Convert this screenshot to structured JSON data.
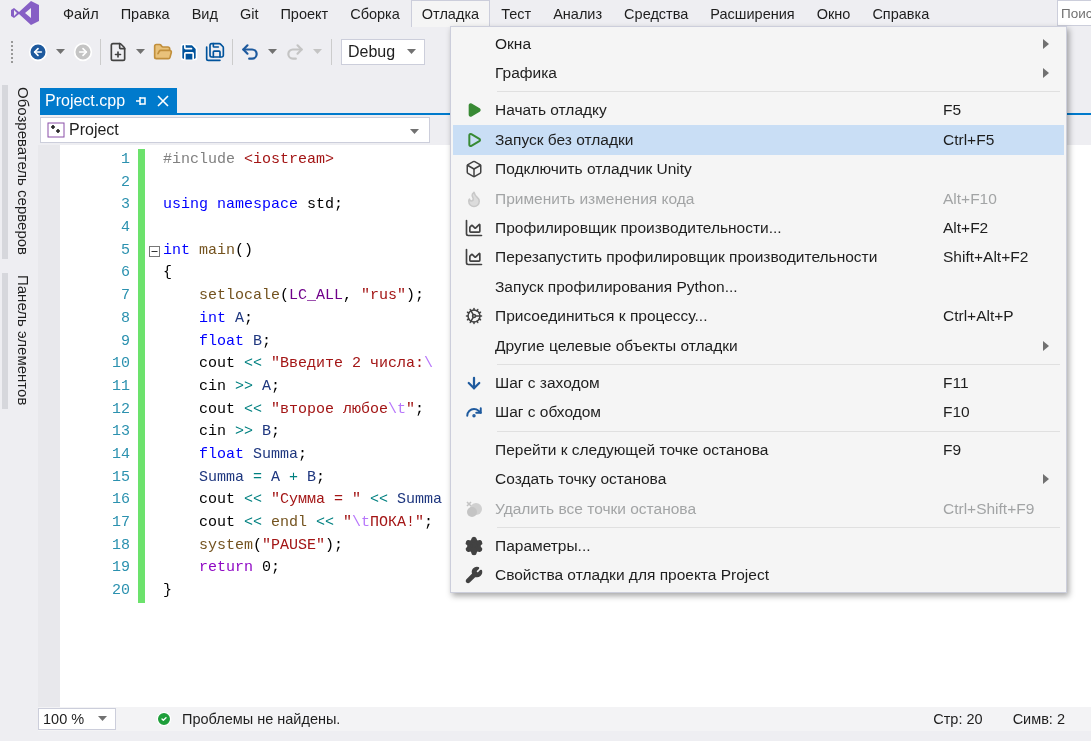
{
  "menubar": [
    {
      "label": "Файл",
      "selected": false
    },
    {
      "label": "Правка",
      "selected": false
    },
    {
      "label": "Вид",
      "selected": false
    },
    {
      "label": "Git",
      "selected": false
    },
    {
      "label": "Проект",
      "selected": false
    },
    {
      "label": "Сборка",
      "selected": false
    },
    {
      "label": "Отладка",
      "selected": true
    },
    {
      "label": "Тест",
      "selected": false
    },
    {
      "label": "Анализ",
      "selected": false
    },
    {
      "label": "Средства",
      "selected": false
    },
    {
      "label": "Расширения",
      "selected": false
    },
    {
      "label": "Окно",
      "selected": false
    },
    {
      "label": "Справка",
      "selected": false
    }
  ],
  "search": {
    "placeholder": "Поис"
  },
  "toolbar": {
    "buttons": [
      {
        "disabled": false
      },
      {
        "disabled": true
      },
      {
        "disabled": false
      },
      {
        "disabled": false
      },
      {
        "disabled": false
      },
      {
        "disabled": false
      },
      {
        "disabled": false
      },
      {
        "disabled": true
      }
    ],
    "configuration": "Debug"
  },
  "side_tabs": [
    "Обозреватель серверов",
    "Панель элементов"
  ],
  "document_tab": {
    "title": "Project.cpp",
    "selected": true
  },
  "navigation": {
    "scope": "Project"
  },
  "code_lines": [
    {
      "number": "1",
      "tokens": [
        {
          "text": "#include",
          "kind": "pre"
        },
        {
          "text": " <iostream>",
          "kind": "str"
        }
      ]
    },
    {
      "number": "2"
    },
    {
      "number": "3",
      "tokens": [
        {
          "text": "using",
          "kind": "kw"
        },
        {
          "text": " namespace",
          "kind": "kw"
        },
        {
          "text": " std;",
          "kind": "plain"
        }
      ]
    },
    {
      "number": "4"
    },
    {
      "number": "5",
      "fold": true,
      "tokens": [
        {
          "text": "int",
          "kind": "kw"
        },
        {
          "text": " main",
          "kind": "fn"
        },
        {
          "text": "()",
          "kind": "plain"
        }
      ]
    },
    {
      "number": "6",
      "tokens": [
        {
          "text": "{",
          "kind": "plain"
        }
      ]
    },
    {
      "number": "7",
      "tokens": [
        {
          "text": "    setlocale",
          "kind": "fn"
        },
        {
          "text": "(",
          "kind": "plain"
        },
        {
          "text": "LC_ALL",
          "kind": "macro"
        },
        {
          "text": ",",
          "kind": "plain"
        },
        {
          "text": " \"rus\"",
          "kind": "str"
        },
        {
          "text": ");",
          "kind": "plain"
        }
      ]
    },
    {
      "number": "8",
      "tokens": [
        {
          "text": "    int",
          "kind": "kw"
        },
        {
          "text": " A",
          "kind": "var"
        },
        {
          "text": ";",
          "kind": "plain"
        }
      ]
    },
    {
      "number": "9",
      "tokens": [
        {
          "text": "    float",
          "kind": "kw"
        },
        {
          "text": " B",
          "kind": "var"
        },
        {
          "text": ";",
          "kind": "plain"
        }
      ]
    },
    {
      "number": "10",
      "tokens": [
        {
          "text": "    cout",
          "kind": "plain"
        },
        {
          "text": " <<",
          "kind": "op"
        },
        {
          "text": " \"Введите 2 числа:",
          "kind": "str"
        },
        {
          "text": "\\",
          "kind": "esc"
        }
      ]
    },
    {
      "number": "11",
      "tokens": [
        {
          "text": "    cin",
          "kind": "plain"
        },
        {
          "text": " >>",
          "kind": "op"
        },
        {
          "text": " A",
          "kind": "var"
        },
        {
          "text": ";",
          "kind": "plain"
        }
      ]
    },
    {
      "number": "12",
      "tokens": [
        {
          "text": "    cout",
          "kind": "plain"
        },
        {
          "text": " <<",
          "kind": "op"
        },
        {
          "text": " \"второе любое",
          "kind": "str"
        },
        {
          "text": "\\t",
          "kind": "esc"
        },
        {
          "text": "\"",
          "kind": "str"
        },
        {
          "text": ";",
          "kind": "plain"
        }
      ]
    },
    {
      "number": "13",
      "tokens": [
        {
          "text": "    cin",
          "kind": "plain"
        },
        {
          "text": " >>",
          "kind": "op"
        },
        {
          "text": " B",
          "kind": "var"
        },
        {
          "text": ";",
          "kind": "plain"
        }
      ]
    },
    {
      "number": "14",
      "tokens": [
        {
          "text": "    float",
          "kind": "kw"
        },
        {
          "text": " Summa",
          "kind": "var"
        },
        {
          "text": ";",
          "kind": "plain"
        }
      ]
    },
    {
      "number": "15",
      "tokens": [
        {
          "text": "    Summa",
          "kind": "var"
        },
        {
          "text": " =",
          "kind": "op"
        },
        {
          "text": " A",
          "kind": "var"
        },
        {
          "text": " +",
          "kind": "op"
        },
        {
          "text": " B",
          "kind": "var"
        },
        {
          "text": ";",
          "kind": "plain"
        }
      ]
    },
    {
      "number": "16",
      "tokens": [
        {
          "text": "    cout",
          "kind": "plain"
        },
        {
          "text": " <<",
          "kind": "op"
        },
        {
          "text": " \"Сумма = \"",
          "kind": "str"
        },
        {
          "text": " <<",
          "kind": "op"
        },
        {
          "text": " Summa",
          "kind": "var"
        }
      ]
    },
    {
      "number": "17",
      "tokens": [
        {
          "text": "    cout",
          "kind": "plain"
        },
        {
          "text": " <<",
          "kind": "op"
        },
        {
          "text": " endl",
          "kind": "fn"
        },
        {
          "text": " <<",
          "kind": "op"
        },
        {
          "text": " \"",
          "kind": "str"
        },
        {
          "text": "\\t",
          "kind": "esc"
        },
        {
          "text": "ПОКА!\"",
          "kind": "str"
        },
        {
          "text": ";",
          "kind": "plain"
        }
      ]
    },
    {
      "number": "18",
      "tokens": [
        {
          "text": "    system",
          "kind": "fn"
        },
        {
          "text": "(",
          "kind": "plain"
        },
        {
          "text": "\"PAUSE\"",
          "kind": "str"
        },
        {
          "text": ");",
          "kind": "plain"
        }
      ]
    },
    {
      "number": "19",
      "tokens": [
        {
          "text": "    return",
          "kind": "ctl"
        },
        {
          "text": " 0;",
          "kind": "plain"
        }
      ]
    },
    {
      "number": "20",
      "tokens": [
        {
          "text": "}",
          "kind": "plain"
        }
      ]
    }
  ],
  "debug_menu": [
    {
      "kind": "item",
      "label": "Окна",
      "submenu": true,
      "selected": false,
      "disabled": false
    },
    {
      "kind": "item",
      "label": "Графика",
      "submenu": true,
      "selected": false,
      "disabled": false
    },
    {
      "kind": "separator"
    },
    {
      "kind": "item",
      "label": "Начать отладку",
      "shortcut": "F5",
      "submenu": false,
      "selected": false,
      "disabled": false
    },
    {
      "kind": "item",
      "label": "Запуск без отладки",
      "shortcut": "Ctrl+F5",
      "submenu": false,
      "selected": true,
      "disabled": false
    },
    {
      "kind": "item",
      "label": "Подключить отладчик Unity",
      "submenu": false,
      "selected": false,
      "disabled": false
    },
    {
      "kind": "item",
      "label": "Применить изменения кода",
      "shortcut": "Alt+F10",
      "submenu": false,
      "selected": false,
      "disabled": true
    },
    {
      "kind": "item",
      "label": "Профилировщик производительности...",
      "shortcut": "Alt+F2",
      "submenu": false,
      "selected": false,
      "disabled": false
    },
    {
      "kind": "item",
      "label": "Перезапустить профилировщик производительности",
      "shortcut": "Shift+Alt+F2",
      "submenu": false,
      "selected": false,
      "disabled": false
    },
    {
      "kind": "item",
      "label": "Запуск профилирования Python...",
      "submenu": false,
      "selected": false,
      "disabled": false
    },
    {
      "kind": "item",
      "label": "Присоединиться к процессу...",
      "shortcut": "Ctrl+Alt+P",
      "submenu": false,
      "selected": false,
      "disabled": false
    },
    {
      "kind": "item",
      "label": "Другие целевые объекты отладки",
      "submenu": true,
      "selected": false,
      "disabled": false
    },
    {
      "kind": "separator"
    },
    {
      "kind": "item",
      "label": "Шаг с заходом",
      "shortcut": "F11",
      "submenu": false,
      "selected": false,
      "disabled": false
    },
    {
      "kind": "item",
      "label": "Шаг с обходом",
      "shortcut": "F10",
      "submenu": false,
      "selected": false,
      "disabled": false
    },
    {
      "kind": "separator"
    },
    {
      "kind": "item",
      "label": "Перейти к следующей точке останова",
      "shortcut": "F9",
      "submenu": false,
      "selected": false,
      "disabled": false
    },
    {
      "kind": "item",
      "label": "Создать точку останова",
      "submenu": true,
      "selected": false,
      "disabled": false
    },
    {
      "kind": "item",
      "label": "Удалить все точки останова",
      "shortcut": "Ctrl+Shift+F9",
      "submenu": false,
      "selected": false,
      "disabled": true
    },
    {
      "kind": "separator"
    },
    {
      "kind": "item",
      "label": "Параметры...",
      "submenu": false,
      "selected": false,
      "disabled": false
    },
    {
      "kind": "item",
      "label": "Свойства отладки для проекта Project",
      "submenu": false,
      "selected": false,
      "disabled": false
    }
  ],
  "status_bar": {
    "zoom": "100 %",
    "issues": "Проблемы не найдены.",
    "line": "Стр: 20",
    "column": "Симв: 2"
  }
}
